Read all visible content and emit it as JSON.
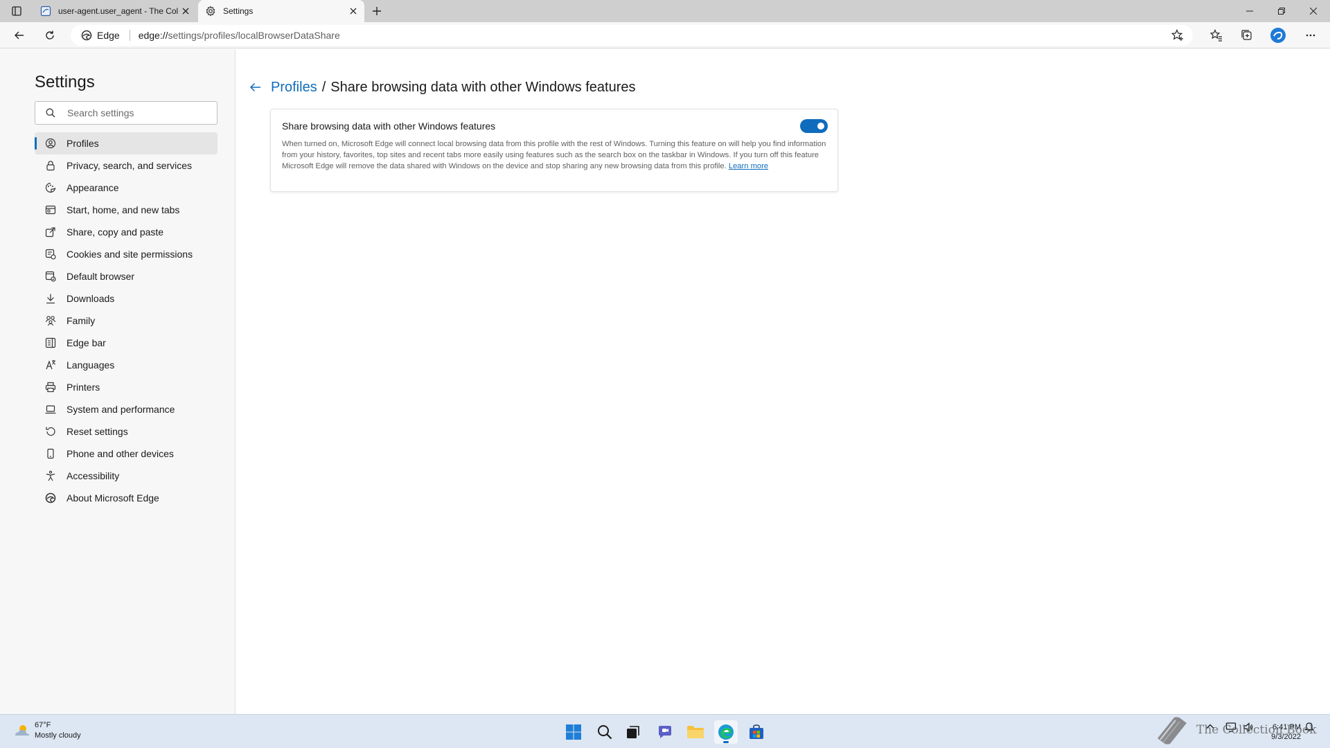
{
  "tabs": [
    {
      "title": "user-agent.user_agent - The Col",
      "active": false
    },
    {
      "title": "Settings",
      "active": true
    }
  ],
  "address_bar": {
    "site_label": "Edge",
    "url_scheme": "edge://",
    "url_path": "settings/profiles/localBrowserDataShare"
  },
  "sidebar": {
    "title": "Settings",
    "search_placeholder": "Search settings",
    "items": [
      {
        "label": "Profiles",
        "icon": "profile-icon",
        "selected": true
      },
      {
        "label": "Privacy, search, and services",
        "icon": "lock-icon"
      },
      {
        "label": "Appearance",
        "icon": "appearance-icon"
      },
      {
        "label": "Start, home, and new tabs",
        "icon": "home-tabs-icon"
      },
      {
        "label": "Share, copy and paste",
        "icon": "share-icon"
      },
      {
        "label": "Cookies and site permissions",
        "icon": "cookies-icon"
      },
      {
        "label": "Default browser",
        "icon": "default-browser-icon"
      },
      {
        "label": "Downloads",
        "icon": "download-icon"
      },
      {
        "label": "Family",
        "icon": "family-icon"
      },
      {
        "label": "Edge bar",
        "icon": "edge-bar-icon"
      },
      {
        "label": "Languages",
        "icon": "languages-icon"
      },
      {
        "label": "Printers",
        "icon": "printer-icon"
      },
      {
        "label": "System and performance",
        "icon": "laptop-icon"
      },
      {
        "label": "Reset settings",
        "icon": "reset-icon"
      },
      {
        "label": "Phone and other devices",
        "icon": "phone-icon"
      },
      {
        "label": "Accessibility",
        "icon": "accessibility-icon"
      },
      {
        "label": "About Microsoft Edge",
        "icon": "edge-logo-icon"
      }
    ]
  },
  "main": {
    "breadcrumb_parent": "Profiles",
    "breadcrumb_separator": "/",
    "breadcrumb_current": "Share browsing data with other Windows features",
    "card": {
      "title": "Share browsing data with other Windows features",
      "toggle_on": true,
      "description": "When turned on, Microsoft Edge will connect local browsing data from this profile with the rest of Windows. Turning this feature on will help you find information from your history, favorites, top sites and recent tabs more easily using features such as the search box on the taskbar in Windows. If you turn off this feature Microsoft Edge will remove the data shared with Windows on the device and stop sharing any new browsing data from this profile.",
      "learn_more": "Learn more"
    }
  },
  "taskbar": {
    "weather_temp": "67°F",
    "weather_desc": "Mostly cloudy",
    "time": "6:41 PM",
    "date": "9/3/2022",
    "watermark": "The Collection Book"
  },
  "colors": {
    "accent": "#0f6cbd",
    "sidebar_bg": "#f7f7f7",
    "tabstrip_bg": "#cfcfcf",
    "taskbar_bg": "#dde7f3"
  }
}
